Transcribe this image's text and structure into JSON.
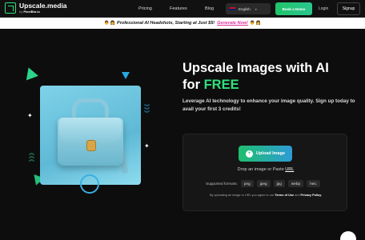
{
  "header": {
    "brand_title": "Upscale.media",
    "brand_by": "by",
    "brand_company": "PixelBin.io",
    "nav": [
      "Pricing",
      "Features",
      "Blog"
    ],
    "language": "English",
    "demo_button": "Book a Demo",
    "login": "Login",
    "signup": "Signup"
  },
  "promo": {
    "text": "Professional AI Headshots, Starting at Just $5!",
    "link": "Generate Now!",
    "emoji": "👨 👩"
  },
  "hero": {
    "title_line1": "Upscale Images with AI",
    "title_for": "for ",
    "title_free": "FREE",
    "subtitle": "Leverage AI technology to enhance your image quality. Sign up today to avail your first 3 credits!"
  },
  "upload": {
    "button": "Upload Image",
    "drop_text": "Drop an image or Paste ",
    "drop_url": "URL",
    "formats_label": "Supported formats:",
    "formats": [
      "png",
      "jpeg",
      "jpg",
      "webp",
      "heic"
    ],
    "terms_prefix": "By uploading an image or URL you agree to our ",
    "terms_link": "Terms of Use",
    "terms_and": " and ",
    "privacy_link": "Privacy Policy."
  },
  "colors": {
    "accent": "#2fe07d",
    "upload_gradient_start": "#1fbf6e",
    "upload_gradient_end": "#2d9bd6",
    "promo_link": "#e0309a"
  }
}
